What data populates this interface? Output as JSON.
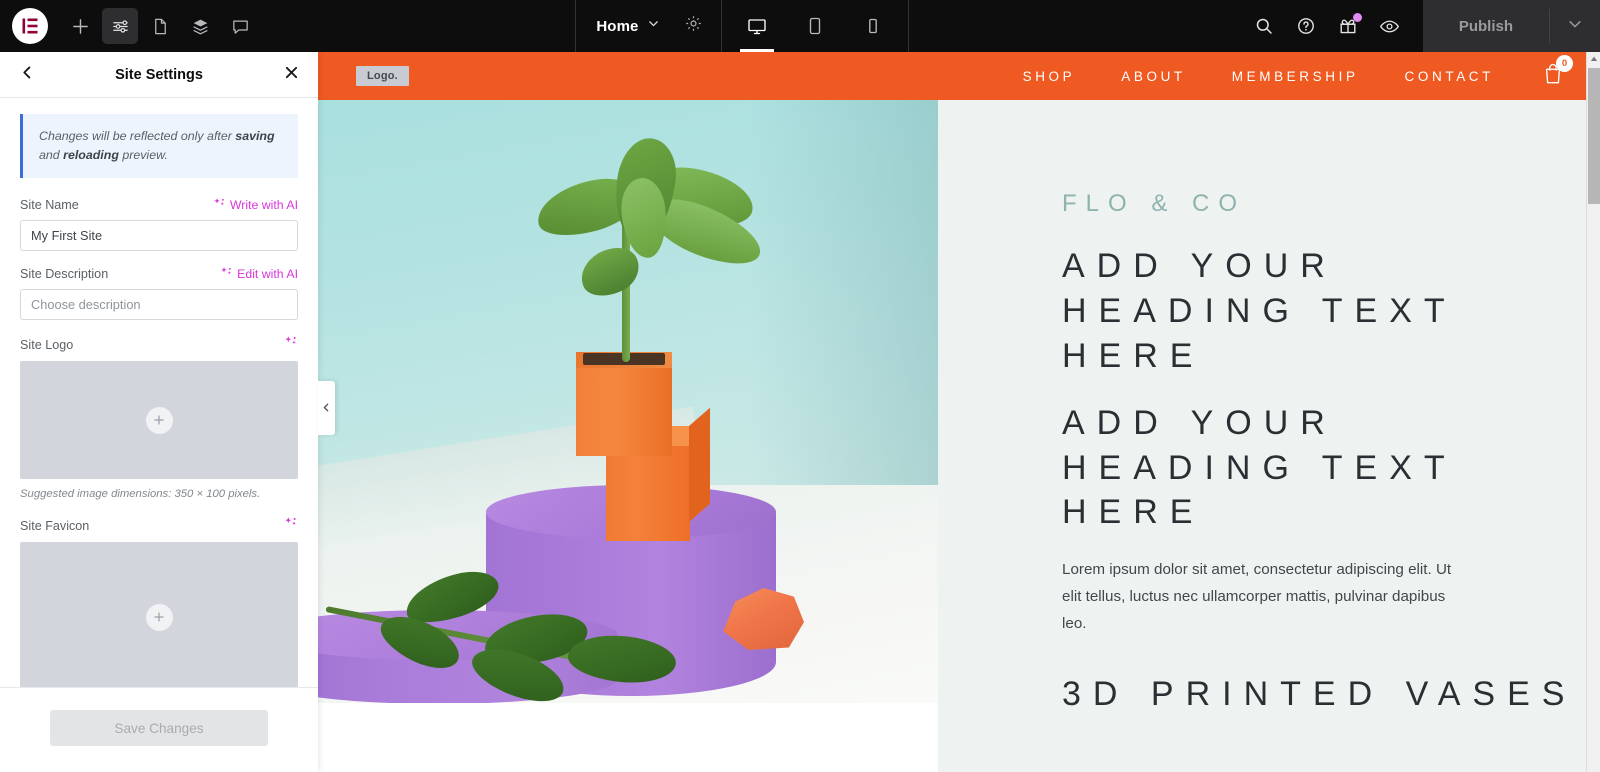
{
  "topbar": {
    "logo_icon": "elementor-logo-icon",
    "left_icons": [
      {
        "name": "add-element-icon",
        "label": "Add Element"
      },
      {
        "name": "site-settings-icon",
        "label": "Site Settings",
        "active": true
      },
      {
        "name": "page-settings-icon",
        "label": "Page Settings"
      },
      {
        "name": "structure-icon",
        "label": "Structure"
      },
      {
        "name": "comments-icon",
        "label": "Comments"
      }
    ],
    "page_name": "Home",
    "page_chevron": "chevron-down-icon",
    "gear_icon": "gear-icon",
    "devices": [
      {
        "name": "desktop",
        "icon": "desktop-icon",
        "active": true
      },
      {
        "name": "tablet",
        "icon": "tablet-icon",
        "active": false
      },
      {
        "name": "mobile",
        "icon": "mobile-icon",
        "active": false
      }
    ],
    "actions": [
      {
        "name": "search-icon",
        "label": "Search"
      },
      {
        "name": "help-icon",
        "label": "Help"
      },
      {
        "name": "gift-icon",
        "label": "What's New",
        "badge": true
      },
      {
        "name": "preview-icon",
        "label": "Preview Changes"
      }
    ],
    "publish_label": "Publish",
    "publish_chevron": "chevron-down-icon"
  },
  "panel": {
    "back_icon": "chevron-left-icon",
    "title": "Site Settings",
    "close_icon": "close-icon",
    "notice": {
      "text_1": "Changes will be reflected only after ",
      "bold_1": "saving",
      "text_2": " and ",
      "bold_2": "reloading",
      "text_3": " preview."
    },
    "site_name": {
      "label": "Site Name",
      "ai_label": "Write with AI",
      "ai_icon": "ai-sparkle-icon",
      "value": "My First Site"
    },
    "site_description": {
      "label": "Site Description",
      "ai_label": "Edit with AI",
      "ai_icon": "ai-sparkle-icon",
      "value": "",
      "placeholder": "Choose description"
    },
    "site_logo": {
      "label": "Site Logo",
      "ai_icon": "ai-sparkle-icon",
      "add_icon": "plus-icon",
      "hint": "Suggested image dimensions: 350 × 100 pixels."
    },
    "site_favicon": {
      "label": "Site Favicon",
      "ai_icon": "ai-sparkle-icon",
      "add_icon": "plus-icon"
    },
    "save_label": "Save Changes",
    "collapse_icon": "chevron-left-icon"
  },
  "site": {
    "header": {
      "logo_placeholder": "Logo.",
      "bg_color": "#ef5a22",
      "nav": [
        {
          "label": "SHOP"
        },
        {
          "label": "ABOUT"
        },
        {
          "label": "MEMBERSHIP"
        },
        {
          "label": "CONTACT"
        }
      ],
      "cart_icon": "shopping-bag-icon",
      "cart_count": "0"
    },
    "hero": {
      "eyebrow": "FLO & CO",
      "eyebrow_color": "#8fb3ae",
      "heading": "ADD YOUR HEADING TEXT HERE",
      "subheading": "ADD YOUR HEADING TEXT HERE",
      "paragraph": "Lorem ipsum dolor sit amet, consectetur adipiscing elit. Ut elit tellus, luctus nec ullamcorper mattis, pulvinar dapibus leo.",
      "footer_heading": "3D PRINTED VASES",
      "bg_color": "#eef3f1"
    },
    "photo_alt": "Jade plant in orange cube planter on purple cylinder podiums with mint background"
  }
}
